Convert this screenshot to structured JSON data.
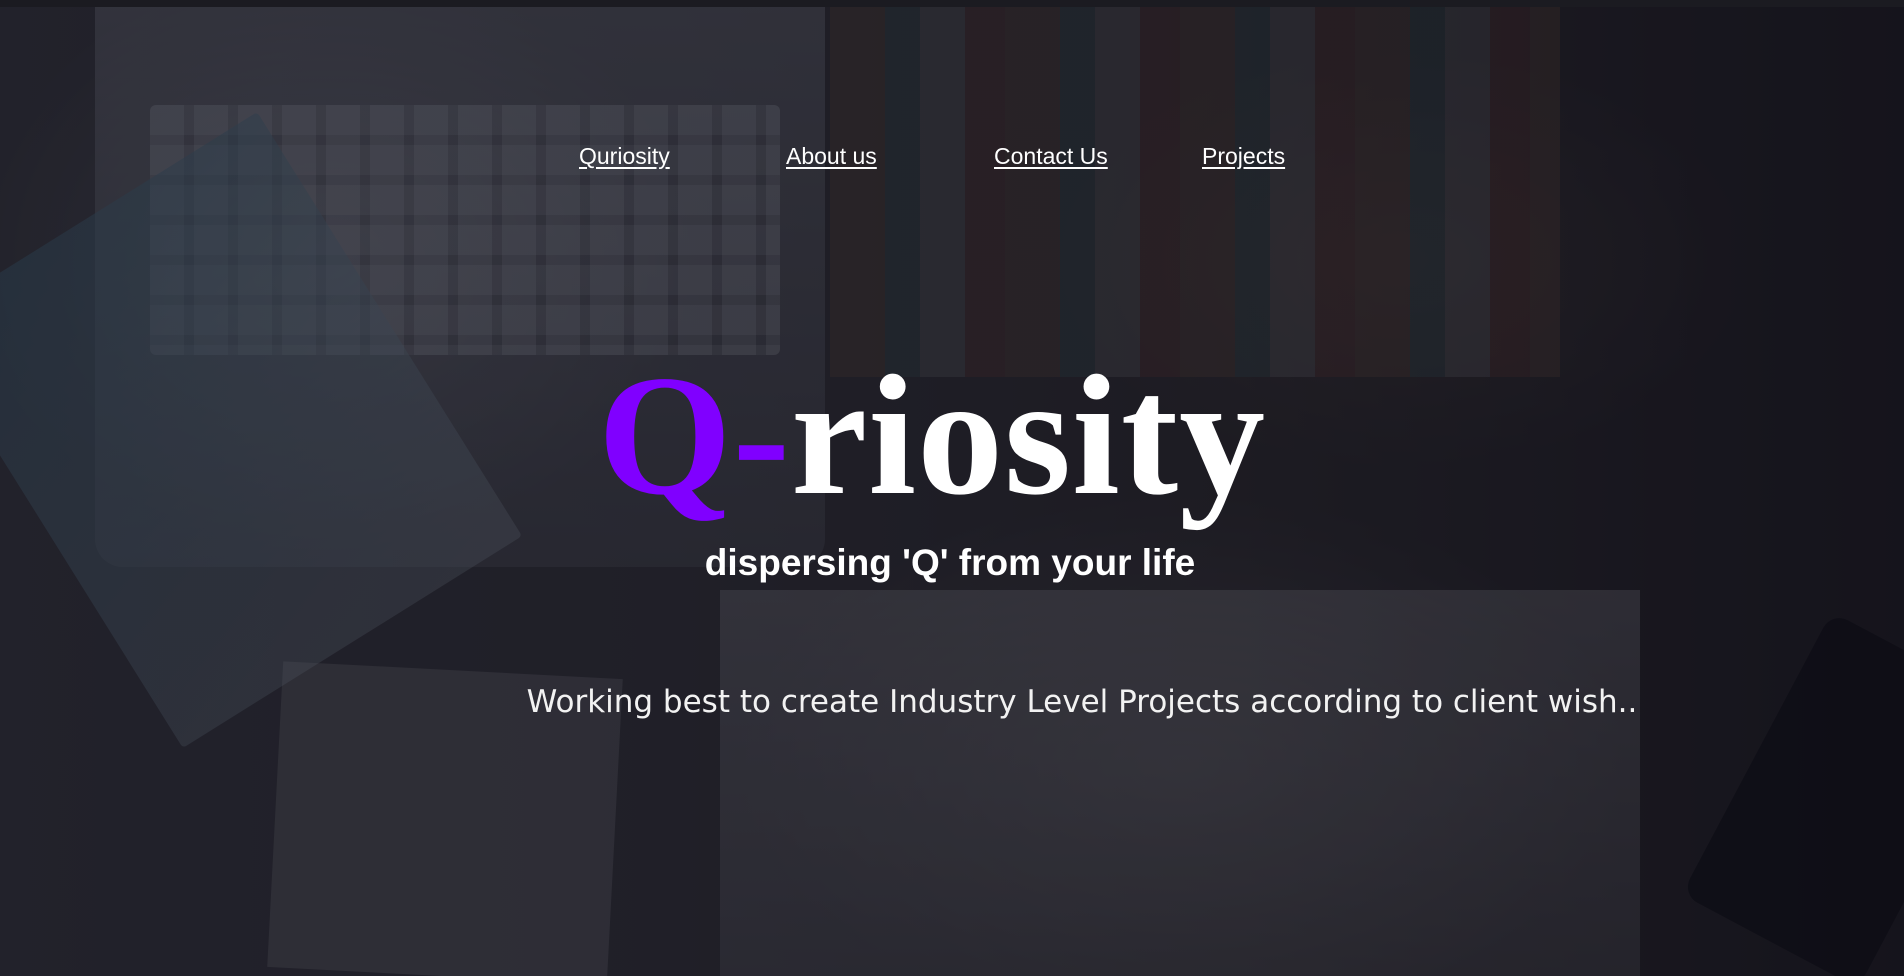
{
  "nav": {
    "items": [
      {
        "label": "Quriosity"
      },
      {
        "label": "About us"
      },
      {
        "label": "Contact Us"
      },
      {
        "label": "Projects"
      }
    ]
  },
  "hero": {
    "title_prefix": "Q-",
    "title_rest": "riosity",
    "tagline": "dispersing 'Q' from your life",
    "description": "Working best to create Industry Level Projects according to client wish.."
  },
  "colors": {
    "accent": "#8000ff",
    "text": "#ffffff"
  }
}
